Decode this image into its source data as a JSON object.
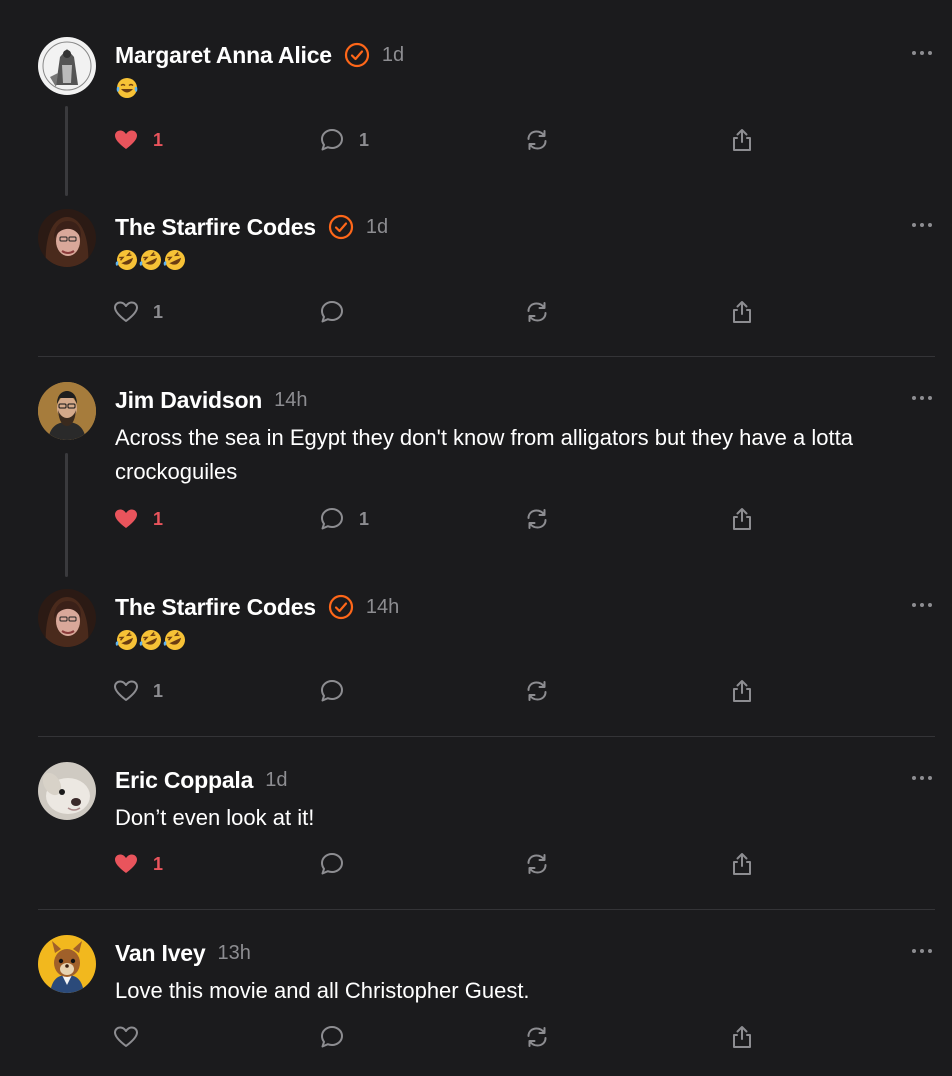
{
  "comments": [
    {
      "author": "Margaret Anna Alice",
      "verified": true,
      "time": "1d",
      "text": "",
      "emoji": [
        "tears-of-joy-emoji"
      ],
      "likes": "1",
      "liked": true,
      "replies": "1",
      "avatar": "engraving-avatar"
    },
    {
      "author": "The Starfire Codes",
      "verified": true,
      "time": "1d",
      "text": "",
      "emoji": [
        "rolling-laughing-emoji",
        "rolling-laughing-emoji",
        "rolling-laughing-emoji"
      ],
      "likes": "1",
      "liked": false,
      "replies": "",
      "avatar": "woman-portrait-avatar"
    },
    {
      "author": "Jim Davidson",
      "verified": false,
      "time": "14h",
      "text": "Across the sea in Egypt they don't know from alligators but they have a lotta crockoguiles",
      "emoji": [],
      "likes": "1",
      "liked": true,
      "replies": "1",
      "avatar": "man-portrait-avatar"
    },
    {
      "author": "The Starfire Codes",
      "verified": true,
      "time": "14h",
      "text": "",
      "emoji": [
        "rolling-laughing-emoji",
        "rolling-laughing-emoji",
        "rolling-laughing-emoji"
      ],
      "likes": "1",
      "liked": false,
      "replies": "",
      "avatar": "woman-portrait-avatar"
    },
    {
      "author": "Eric Coppala",
      "verified": false,
      "time": "1d",
      "text": "Don’t even look at it!",
      "emoji": [],
      "likes": "1",
      "liked": true,
      "replies": "",
      "avatar": "dog-avatar"
    },
    {
      "author": "Van Ivey",
      "verified": false,
      "time": "13h",
      "text": "Love this movie and all Christopher Guest.",
      "emoji": [],
      "likes": "",
      "liked": false,
      "replies": "",
      "avatar": "squirrel-avatar"
    }
  ],
  "icons": {
    "like": "heart-icon",
    "reply": "comment-bubble-icon",
    "restack": "restack-icon",
    "share": "share-icon",
    "more": "more-dots-icon",
    "verified": "verified-badge-icon"
  },
  "colors": {
    "background": "#1b1b1d",
    "liked": "#e9545c",
    "verified": "#ff6719",
    "muted": "#8d8d91"
  }
}
